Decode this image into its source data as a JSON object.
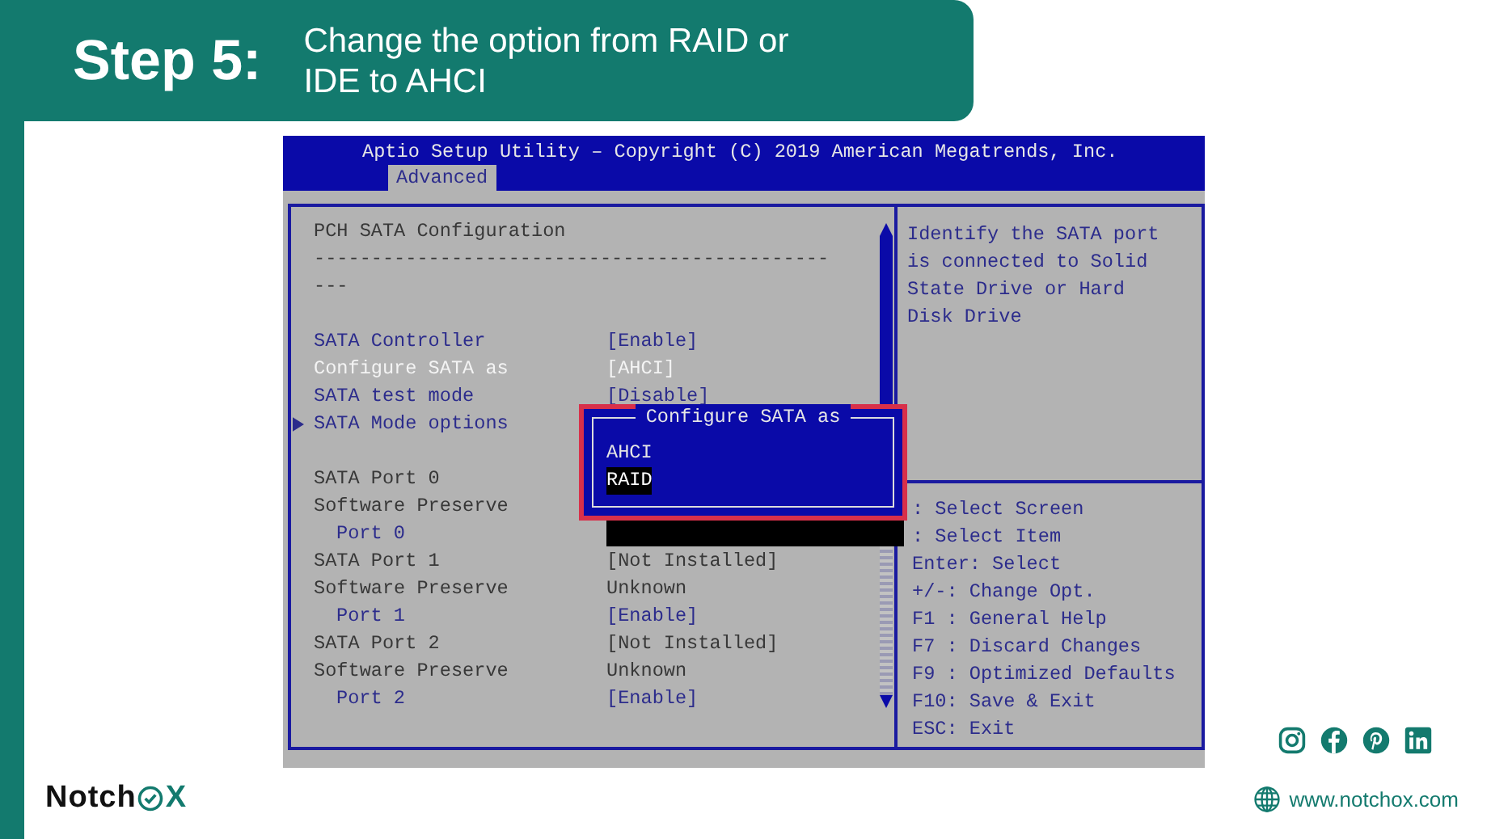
{
  "banner": {
    "step": "Step 5:",
    "instruction": "Change the option from RAID or IDE to AHCI"
  },
  "bios": {
    "title": "Aptio Setup Utility – Copyright (C) 2019 American Megatrends, Inc.",
    "tabs": [
      {
        "label": "Advanced",
        "selected": true
      }
    ],
    "items": [
      {
        "kind": "text",
        "label": "PCH SATA Configuration"
      },
      {
        "kind": "text",
        "label": "---------------------------------------------"
      },
      {
        "kind": "text",
        "label": "---"
      },
      {
        "kind": "blank"
      },
      {
        "kind": "option",
        "label": "SATA Controller",
        "value": "[Enable]",
        "selected": false
      },
      {
        "kind": "option",
        "label": "Configure SATA as",
        "value": "[AHCI]",
        "selected": true
      },
      {
        "kind": "option",
        "label": "SATA test mode",
        "value": "[Disable]",
        "selected": false
      },
      {
        "kind": "submenu",
        "label": "SATA Mode options",
        "selected": false
      },
      {
        "kind": "blank"
      },
      {
        "kind": "text",
        "label": "SATA Port 0"
      },
      {
        "kind": "text",
        "label": "Software Preserve",
        "children": [
          {
            "kind": "option",
            "label": "Port 0",
            "selected": false
          }
        ]
      },
      {
        "kind": "text",
        "label": "SATA Port 1",
        "value": "[Not Installed]"
      },
      {
        "kind": "text",
        "label": "Software Preserve",
        "value": "Unknown",
        "children": [
          {
            "kind": "option",
            "label": "Port 1",
            "value": "[Enable]",
            "selected": false
          }
        ]
      },
      {
        "kind": "text",
        "label": "SATA Port 2",
        "value": "[Not Installed]"
      },
      {
        "kind": "text",
        "label": "Software Preserve",
        "value": "Unknown",
        "children": [
          {
            "kind": "option",
            "label": "Port 2",
            "value": "[Enable]",
            "selected": false
          }
        ]
      }
    ],
    "help": "Identify the SATA port is connected to Solid State Drive or Hard Disk Drive",
    "keys": [
      ": Select Screen",
      ": Select Item",
      "Enter: Select",
      "+/-: Change Opt.",
      "F1 : General Help",
      "F7 : Discard Changes",
      "F9 : Optimized Defaults",
      "F10: Save & Exit",
      "ESC: Exit"
    ],
    "popup": {
      "title": "Configure SATA as",
      "options": [
        {
          "label": "AHCI",
          "selected": false
        },
        {
          "label": "RAID",
          "selected": true
        }
      ]
    }
  },
  "footer": {
    "logo_start": "Notch",
    "logo_end": "X",
    "website": "www.notchox.com"
  }
}
